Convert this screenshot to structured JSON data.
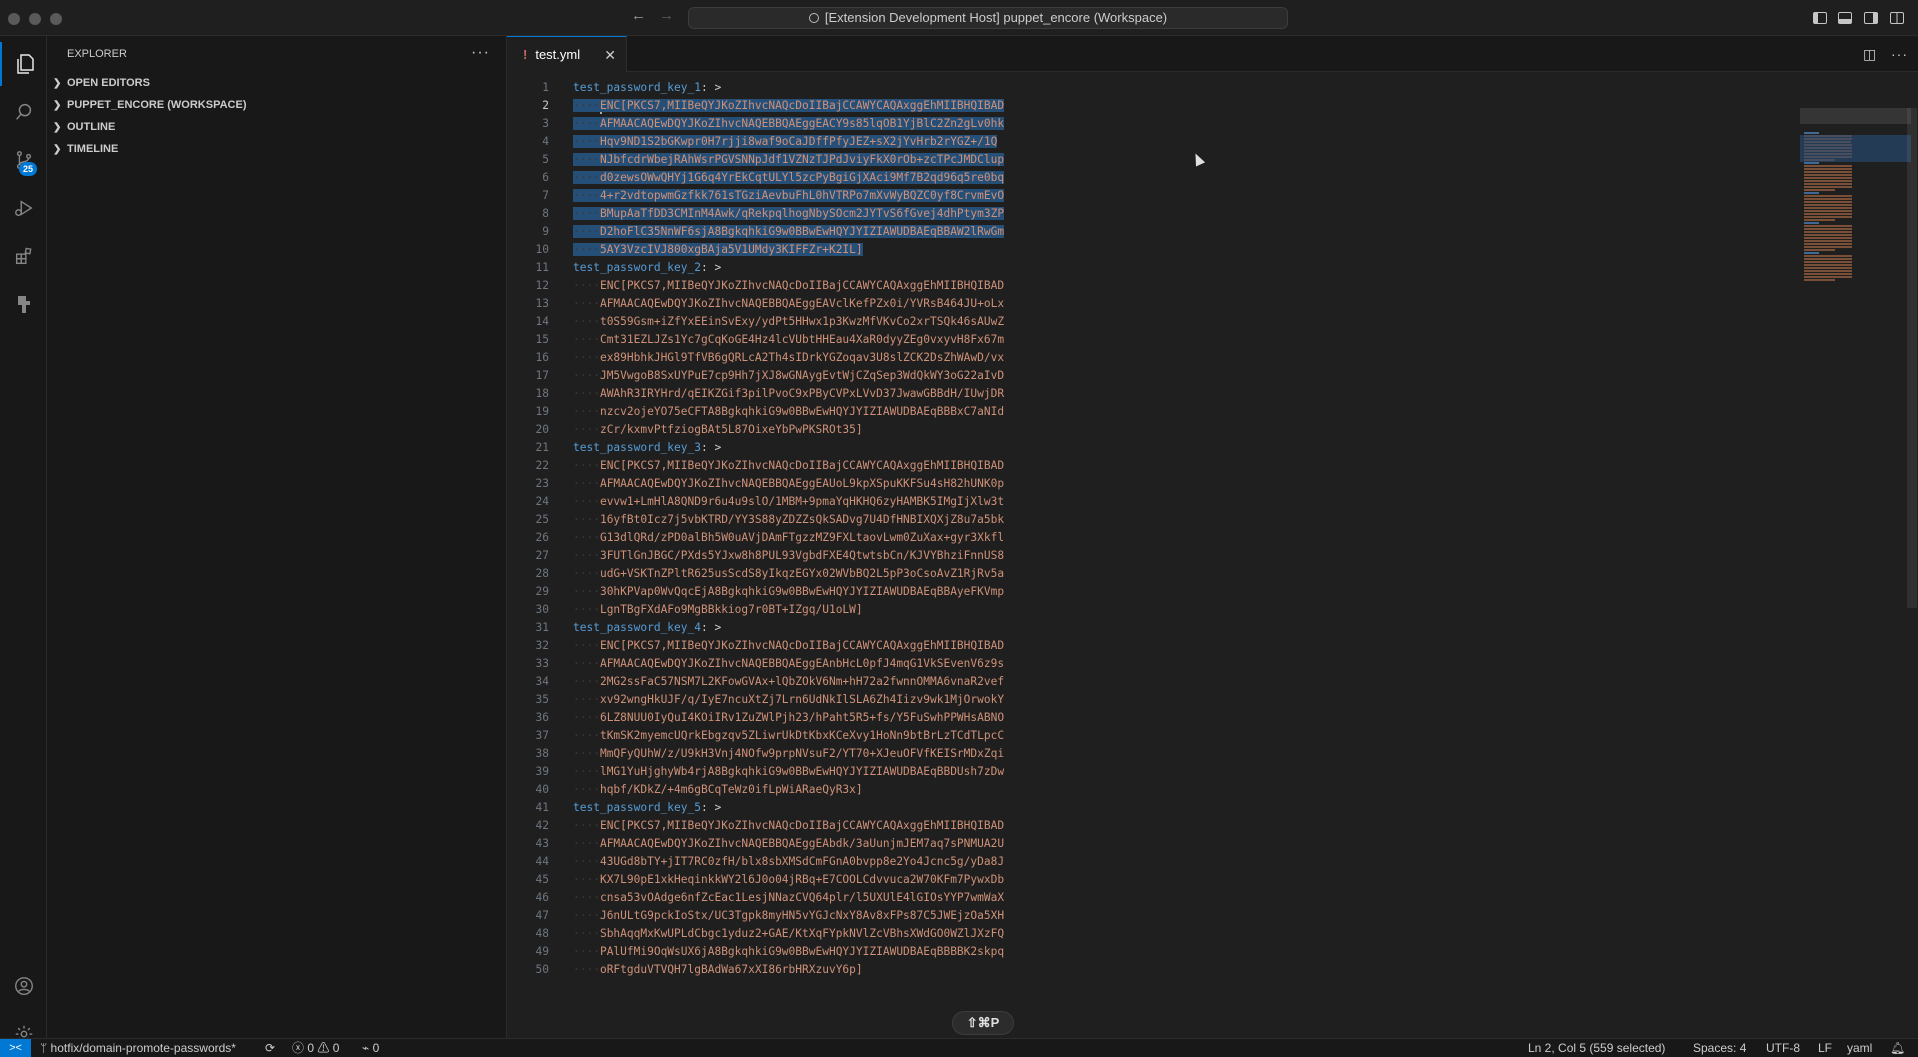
{
  "window": {
    "command_center": "[Extension Development Host] puppet_encore (Workspace)"
  },
  "activity_bar": {
    "source_control_badge": "25"
  },
  "sidebar": {
    "title": "EXPLORER",
    "more": "···",
    "sections": [
      {
        "label": "OPEN EDITORS"
      },
      {
        "label": "PUPPET_ENCORE (WORKSPACE)"
      },
      {
        "label": "OUTLINE"
      },
      {
        "label": "TIMELINE"
      }
    ]
  },
  "editor": {
    "tab_label": "test.yml",
    "tab_marker": "!",
    "lines": [
      {
        "n": "1",
        "key": "test_password_key_1",
        "sep": ": >"
      },
      {
        "n": "2",
        "text": "ENC[PKCS7,MIIBeQYJKoZIhvcNAQcDoIIBajCCAWYCAQAxggEhMIIBHQIBAD"
      },
      {
        "n": "3",
        "text": "AFMAACAQEwDQYJKoZIhvcNAQEBBQAEggEACY9s85lqOB1YjBlC2Zn2gLv0hk"
      },
      {
        "n": "4",
        "text": "Hqv9ND1S2bGKwpr0H7rjji8waf9oCaJDffPfyJEZ+sX2jYvHrb2rYGZ+/1Q"
      },
      {
        "n": "5",
        "text": "NJbfcdrWbejRAhWsrPGVSNNpJdf1VZNzTJPdJviyFkX0rOb+zcTPcJMDClup"
      },
      {
        "n": "6",
        "text": "d0zewsOWwQHYj1G6q4YrEkCqtULYl5zcPyBgiGjXAci9Mf7B2qd96q5re0bq"
      },
      {
        "n": "7",
        "text": "4+r2vdtopwmGzfkk761sTGziAevbuFhL0hVTRPo7mXvWyBQZC0yf8CrvmEvO"
      },
      {
        "n": "8",
        "text": "BMupAaTfDD3CMInM4Awk/qRekpqlhogNbySOcm2JYTvS6fGvej4dhPtym3ZP"
      },
      {
        "n": "9",
        "text": "D2hoFlC35NnWF6sjA8BgkqhkiG9w0BBwEwHQYJYIZIAWUDBAEqBBAW2lRwGm"
      },
      {
        "n": "10",
        "text": "5AY3VzcIVJ800xgBAja5V1UMdy3KIFFZr+K2IL]"
      },
      {
        "n": "11",
        "key": "test_password_key_2",
        "sep": ": >"
      },
      {
        "n": "12",
        "text": "ENC[PKCS7,MIIBeQYJKoZIhvcNAQcDoIIBajCCAWYCAQAxggEhMIIBHQIBAD"
      },
      {
        "n": "13",
        "text": "AFMAACAQEwDQYJKoZIhvcNAQEBBQAEggEAVclKefPZx0i/YVRsB464JU+oLx"
      },
      {
        "n": "14",
        "text": "t0S59Gsm+iZfYxEEinSvExy/ydPt5HHwx1p3KwzMfVKvCo2xrTSQk46sAUwZ"
      },
      {
        "n": "15",
        "text": "Cmt31EZLJZs1Yc7gCqKoGE4Hz4lcVUbtHHEau4XaR0dyyZEg0vxyvH8Fx67m"
      },
      {
        "n": "16",
        "text": "ex89HbhkJHGl9TfVB6gQRLcA2Th4sIDrkYGZoqav3U8slZCK2DsZhWAwD/vx"
      },
      {
        "n": "17",
        "text": "JM5VwgoB8SxUYPuE7cp9Hh7jXJ8wGNAygEvtWjCZqSep3WdQkWY3oG22aIvD"
      },
      {
        "n": "18",
        "text": "AWAhR3IRYHrd/qEIKZGif3pilPvoC9xPByCVPxLVvD37JwawGBBdH/IUwjDR"
      },
      {
        "n": "19",
        "text": "nzcv2ojeYO75eCFTA8BgkqhkiG9w0BBwEwHQYJYIZIAWUDBAEqBBBxC7aNId"
      },
      {
        "n": "20",
        "text": "zCr/kxmvPtfziogBAt5L87OixeYbPwPKSROt35]"
      },
      {
        "n": "21",
        "key": "test_password_key_3",
        "sep": ": >"
      },
      {
        "n": "22",
        "text": "ENC[PKCS7,MIIBeQYJKoZIhvcNAQcDoIIBajCCAWYCAQAxggEhMIIBHQIBAD"
      },
      {
        "n": "23",
        "text": "AFMAACAQEwDQYJKoZIhvcNAQEBBQAEggEAUoL9kpXSpuKKFSu4sH82hUNK0p"
      },
      {
        "n": "24",
        "text": "evvw1+LmHlA8QND9r6u4u9slO/1MBM+9pmaYqHKHQ6zyHAMBK5IMgIjXlw3t"
      },
      {
        "n": "25",
        "text": "16yfBt0Icz7j5vbKTRD/YY3S88yZDZZsQkSADvg7U4DfHNBIXQXjZ8u7a5bk"
      },
      {
        "n": "26",
        "text": "G13dlQRd/zPD0alBh5W0uAVjDAmFTgzzMZ9FXLtaovLwm0ZuXax+gyr3Xkfl"
      },
      {
        "n": "27",
        "text": "3FUTlGnJBGC/PXds5YJxw8h8PUL93VgbdFXE4QtwtsbCn/KJVYBhziFnnUS8"
      },
      {
        "n": "28",
        "text": "udG+VSKTnZPltR625usScdS8yIkqzEGYx02WVbBQ2L5pP3oCsoAvZ1RjRv5a"
      },
      {
        "n": "29",
        "text": "30hKPVap0WvQqcEjA8BgkqhkiG9w0BBwEwHQYJYIZIAWUDBAEqBBAyeFKVmp"
      },
      {
        "n": "30",
        "text": "LgnTBgFXdAFo9MgBBkkiog7r0BT+IZgq/U1oLW]"
      },
      {
        "n": "31",
        "key": "test_password_key_4",
        "sep": ": >"
      },
      {
        "n": "32",
        "text": "ENC[PKCS7,MIIBeQYJKoZIhvcNAQcDoIIBajCCAWYCAQAxggEhMIIBHQIBAD"
      },
      {
        "n": "33",
        "text": "AFMAACAQEwDQYJKoZIhvcNAQEBBQAEggEAnbHcL0pfJ4mqG1VkSEvenV6z9s"
      },
      {
        "n": "34",
        "text": "2MG2ssFaC57NSM7L2KFowGVAx+lQbZOkV6Nm+hH72a2fwnnOMMA6vnaR2vef"
      },
      {
        "n": "35",
        "text": "xv92wngHkUJF/q/IyE7ncuXtZj7Lrn6UdNkIlSLA6Zh4Iizv9wk1MjOrwokY"
      },
      {
        "n": "36",
        "text": "6LZ8NUU0IyQuI4KOiIRv1ZuZWlPjh23/hPaht5R5+fs/Y5FuSwhPPWHsABNO"
      },
      {
        "n": "37",
        "text": "tKmSK2myemcUQrkEbgzqv5ZLiwrUkDtKbxKCeXvy1HoNn9btBrLzTCdTLpcC"
      },
      {
        "n": "38",
        "text": "MmQFyQUhW/z/U9kH3Vnj4NOfw9prpNVsuF2/YT70+XJeuOFVfKEISrMDxZqi"
      },
      {
        "n": "39",
        "text": "lMG1YuHjghyWb4rjA8BgkqhkiG9w0BBwEwHQYJYIZIAWUDBAEqBBDUsh7zDw"
      },
      {
        "n": "40",
        "text": "hqbf/KDkZ/+4m6gBCqTeWz0ifLpWiARaeQyR3x]"
      },
      {
        "n": "41",
        "key": "test_password_key_5",
        "sep": ": >"
      },
      {
        "n": "42",
        "text": "ENC[PKCS7,MIIBeQYJKoZIhvcNAQcDoIIBajCCAWYCAQAxggEhMIIBHQIBAD"
      },
      {
        "n": "43",
        "text": "AFMAACAQEwDQYJKoZIhvcNAQEBBQAEggEAbdk/3aUunjmJEM7aq7sPNMUA2U"
      },
      {
        "n": "44",
        "text": "43UGd8bTY+jIT7RC0zfH/blx8sbXMSdCmFGnA0bvpp8e2Yo4Jcnc5g/yDa8J"
      },
      {
        "n": "45",
        "text": "KX7L90pE1xkHeqinkkWY2l6J0o04jRBq+E7COOLCdvvuca2W70KFm7PywxDb"
      },
      {
        "n": "46",
        "text": "cnsa53vOAdge6nfZcEac1LesjNNazCVQ64plr/l5UXUlE4lGIOsYYP7wmWaX"
      },
      {
        "n": "47",
        "text": "J6nULtG9pckIoStx/UC3Tgpk8myHN5vYGJcNxY8Av8xFPs87C5JWEjzOa5XH"
      },
      {
        "n": "48",
        "text": "SbhAqqMxKwUPLdCbgc1yduz2+GAE/KtXqFYpkNVlZcVBhsXWdGO0WZlJXzFQ"
      },
      {
        "n": "49",
        "text": "PAlUfMi9OqWsUX6jA8BgkqhkiG9w0BBwEwHQYJYIZIAWUDBAEqBBBBK2skpq"
      },
      {
        "n": "50",
        "text": "oRFtgduVTVQH7lgBAdWa67xXI86rbHRXzuvY6p]"
      }
    ]
  },
  "overlay": {
    "shortcut": "⇧⌘P"
  },
  "statusbar": {
    "branch": "hotfix/domain-promote-passwords*",
    "errors": "0",
    "warnings": "0",
    "ports": "0",
    "cursor_position": "Ln 2, Col 5 (559 selected)",
    "spaces": "Spaces: 4",
    "encoding": "UTF-8",
    "eol": "LF",
    "language": "yaml"
  }
}
